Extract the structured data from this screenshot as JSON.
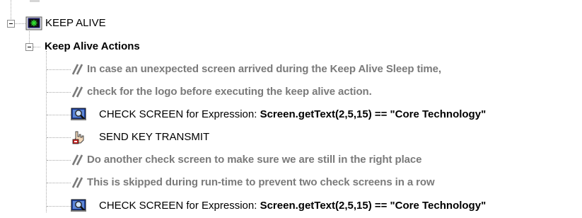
{
  "tree": {
    "root": {
      "label": "KEEP ALIVE",
      "icon": "keep-alive-monitor-icon",
      "expanded": true
    },
    "group": {
      "label": "Keep Alive Actions",
      "expanded": true
    },
    "items": [
      {
        "type": "comment",
        "icon": "comment-slash-icon",
        "text": "In case an unexpected screen arrived during the Keep Alive Sleep time,"
      },
      {
        "type": "comment",
        "icon": "comment-slash-icon",
        "text": "check for the logo before executing the keep alive action."
      },
      {
        "type": "check-screen",
        "icon": "check-screen-magnifier-icon",
        "prefix": "CHECK SCREEN for Expression: ",
        "expression": "Screen.getText(2,5,15) == \"Core Technology\""
      },
      {
        "type": "send-key",
        "icon": "send-key-hand-icon",
        "text": "SEND KEY TRANSMIT"
      },
      {
        "type": "comment",
        "icon": "comment-slash-icon",
        "text": "Do another check screen to make sure we are still in the right place"
      },
      {
        "type": "comment",
        "icon": "comment-slash-icon",
        "text": "This is skipped during run-time to prevent two check screens in a row"
      },
      {
        "type": "check-screen",
        "icon": "check-screen-magnifier-icon",
        "prefix": "CHECK SCREEN for Expression: ",
        "expression": "Screen.getText(2,5,15) == \"Core Technology\""
      }
    ],
    "colors": {
      "comment_text": "#7a7a7a",
      "guide_line": "#a8a8a8",
      "icon_green": "#2fdc2f",
      "icon_frame": "#1d1d8a"
    }
  }
}
